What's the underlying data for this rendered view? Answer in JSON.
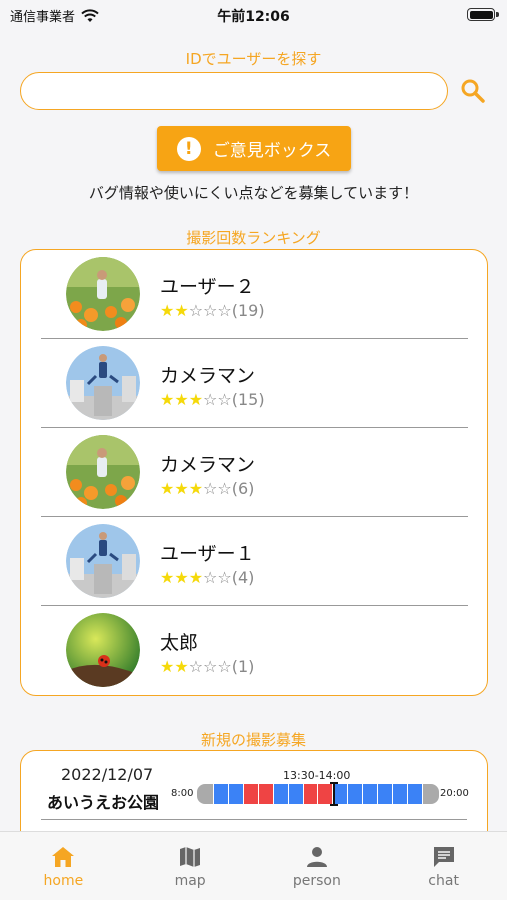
{
  "status_bar": {
    "carrier": "通信事業者",
    "time": "午前12:06"
  },
  "search": {
    "title": "IDでユーザーを探す",
    "value": "",
    "placeholder": ""
  },
  "opinion_box": {
    "label": "ご意見ボックス",
    "note": "バグ情報や使いにくい点などを募集しています！"
  },
  "ranking": {
    "title": "撮影回数ランキング",
    "items": [
      {
        "name": "ユーザー２",
        "rating": 2,
        "count": "(19)",
        "avatar": "flower-field"
      },
      {
        "name": "カメラマン",
        "rating": 3,
        "count": "(15)",
        "avatar": "jumping-person"
      },
      {
        "name": "カメラマン",
        "rating": 3,
        "count": "(6)",
        "avatar": "flower-field"
      },
      {
        "name": "ユーザー１",
        "rating": 3,
        "count": "(4)",
        "avatar": "jumping-person"
      },
      {
        "name": "太郎",
        "rating": 2,
        "count": "(1)",
        "avatar": "ladybug"
      }
    ]
  },
  "recruitment": {
    "title": "新規の撮影募集",
    "items": [
      {
        "date": "2022/12/07",
        "place": "あいうえお公園",
        "time_range": "13:30-14:00",
        "start_label": "8:00",
        "end_label": "20:00",
        "slots": [
          "blue",
          "blue",
          "red",
          "red",
          "blue",
          "blue",
          "red",
          "red",
          "blue",
          "blue",
          "blue",
          "blue",
          "blue",
          "blue"
        ]
      }
    ]
  },
  "tabs": [
    {
      "label": "home",
      "icon": "home-icon",
      "active": true
    },
    {
      "label": "map",
      "icon": "map-icon",
      "active": false
    },
    {
      "label": "person",
      "icon": "person-icon",
      "active": false
    },
    {
      "label": "chat",
      "icon": "chat-icon",
      "active": false
    }
  ],
  "colors": {
    "accent": "#f5a623",
    "star": "#f5d90a",
    "slot_blue": "#3b82f6",
    "slot_red": "#ef4444",
    "slot_cap": "#aaaaaa"
  }
}
